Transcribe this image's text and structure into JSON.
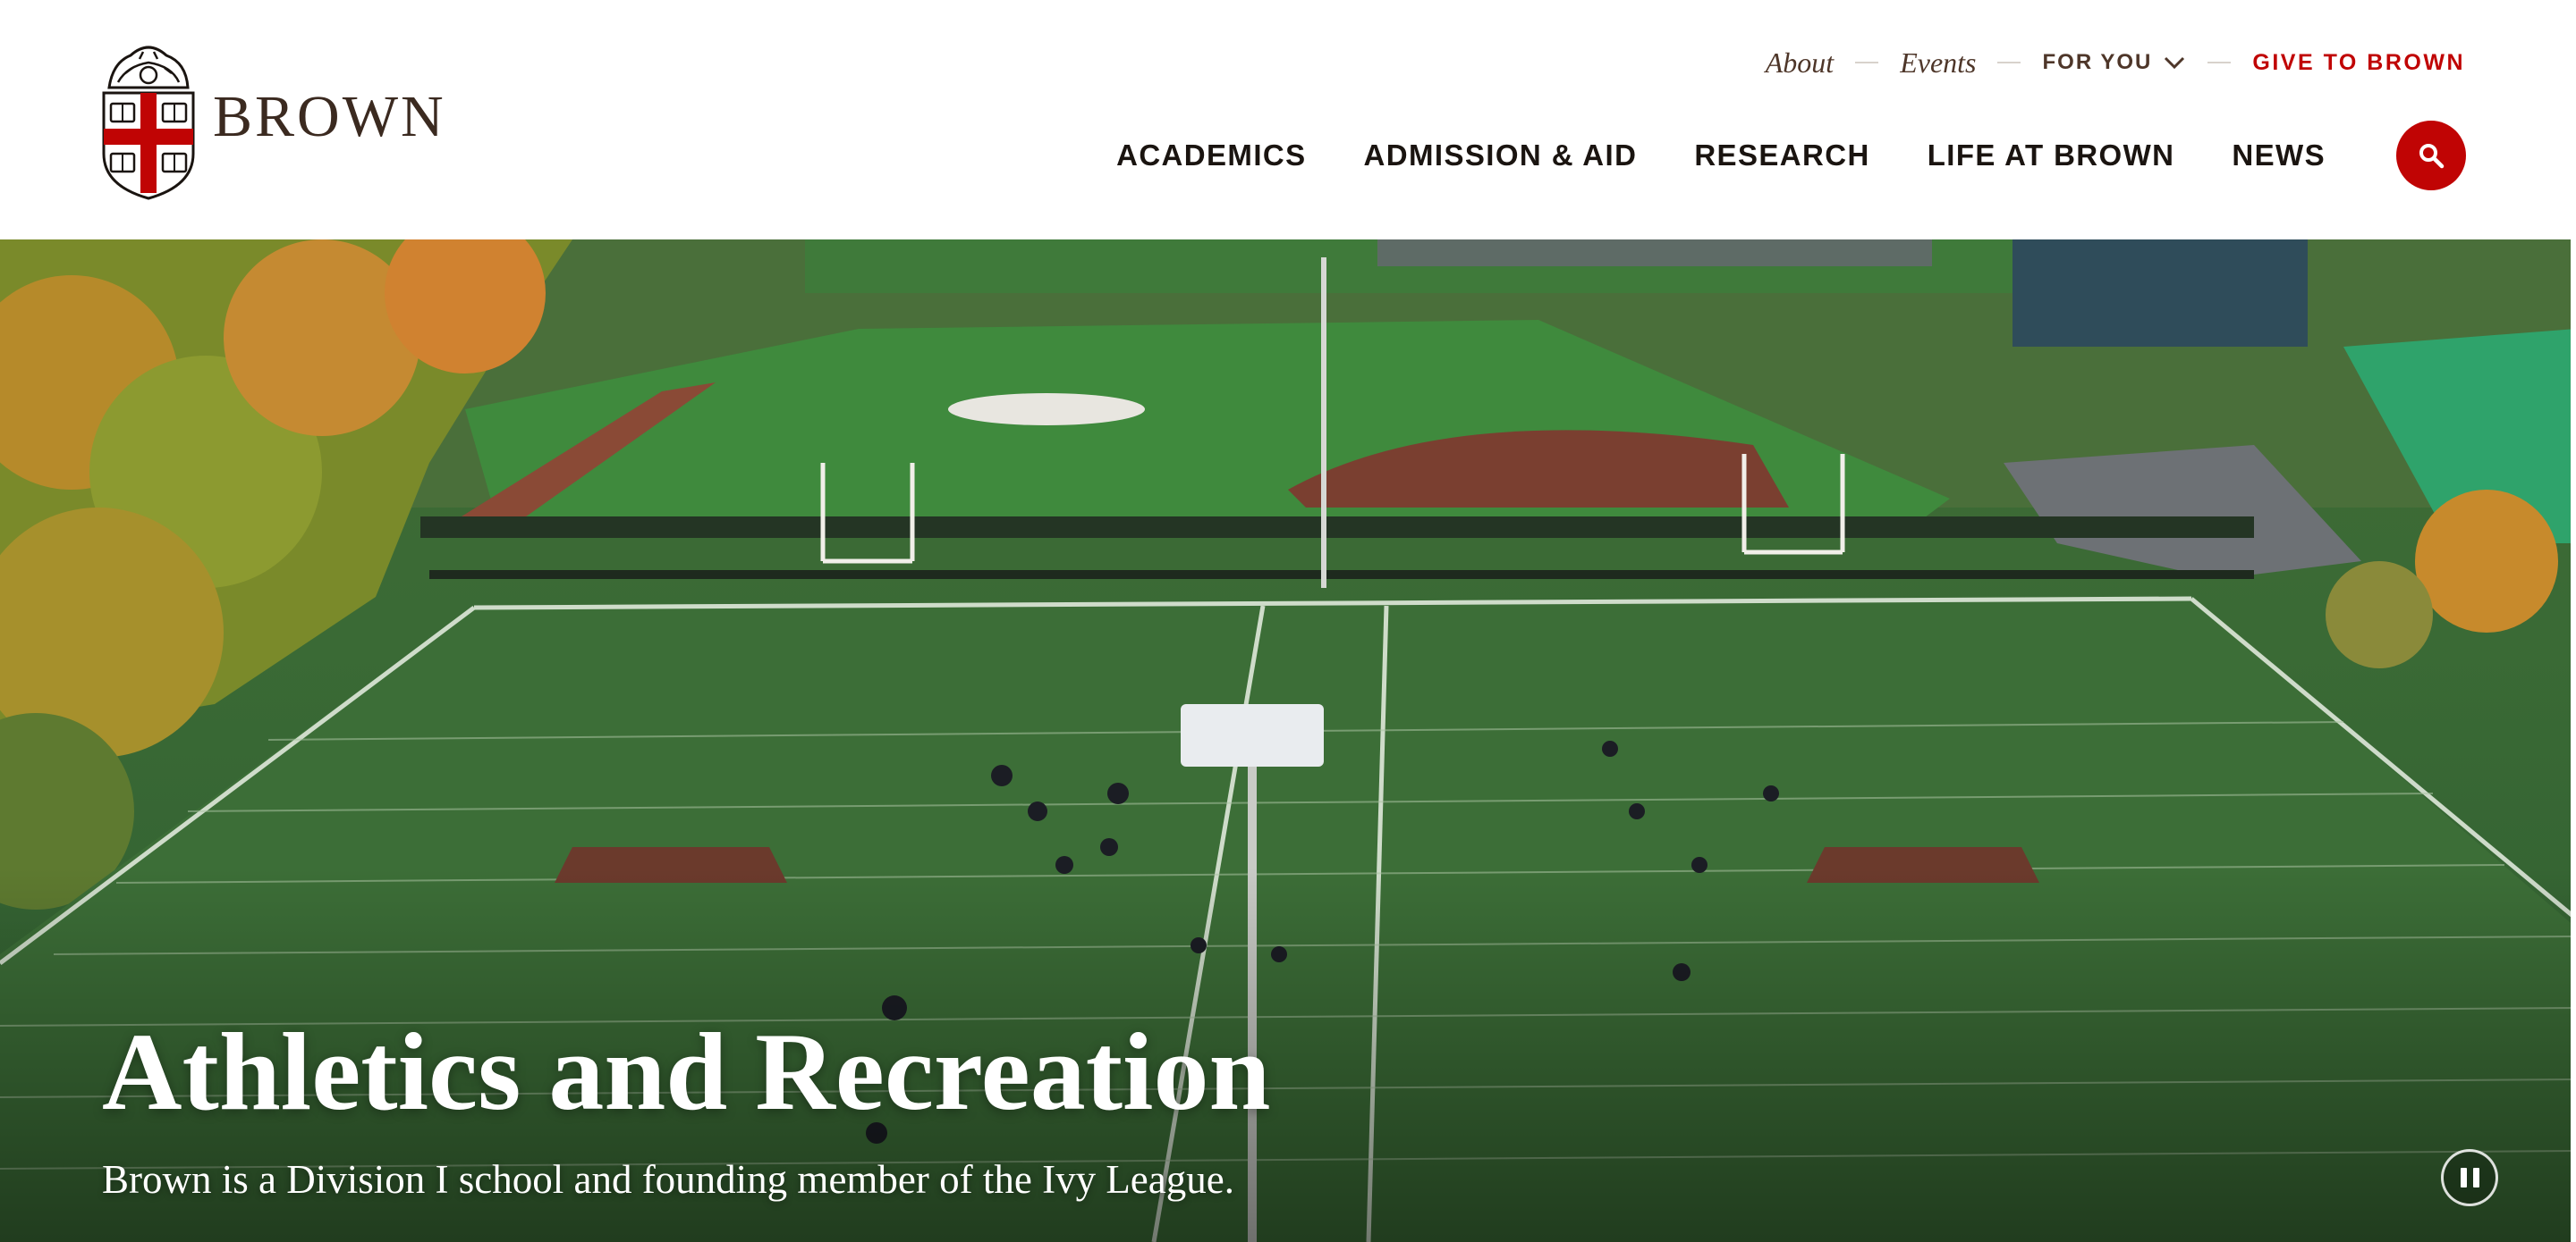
{
  "brand": {
    "wordmark": "BROWN",
    "accent_color": "#c00404",
    "brown_color": "#4e3629"
  },
  "utility_nav": {
    "about": "About",
    "events": "Events",
    "for_you": "FOR YOU",
    "give": "GIVE TO BROWN"
  },
  "primary_nav": {
    "items": [
      {
        "label": "ACADEMICS"
      },
      {
        "label": "ADMISSION & AID"
      },
      {
        "label": "RESEARCH"
      },
      {
        "label": "LIFE AT BROWN"
      },
      {
        "label": "NEWS"
      }
    ],
    "search_icon": "search-icon"
  },
  "hero": {
    "title": "Athletics and Recreation",
    "subtitle": "Brown is a Division I school and founding member of the Ivy League.",
    "pause_icon": "pause-icon"
  }
}
